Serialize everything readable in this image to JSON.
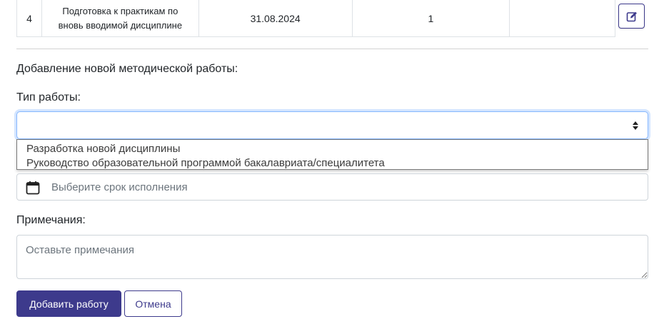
{
  "table": {
    "row": {
      "num": "4",
      "title_line1": "Подготовка к практикам по",
      "title_line2": "вновь вводимой дисциплине",
      "date": "31.08.2024",
      "count": "1",
      "extra": ""
    },
    "edit_icon": "edit-icon"
  },
  "form": {
    "heading": "Добавление новой методической работы:",
    "type_label": "Тип работы:",
    "type_value": "",
    "type_options": [
      "Разработка новой дисциплины",
      "Руководство образовательной программой бакалавриата/специалитета"
    ],
    "deadline_placeholder": "Выберите срок исполнения",
    "notes_label": "Примечания:",
    "notes_placeholder": "Оставьте примечания",
    "submit_label": "Добавить работу",
    "cancel_label": "Отмена"
  },
  "colors": {
    "accent": "#3d3a8c",
    "focus": "#86b7fe"
  }
}
